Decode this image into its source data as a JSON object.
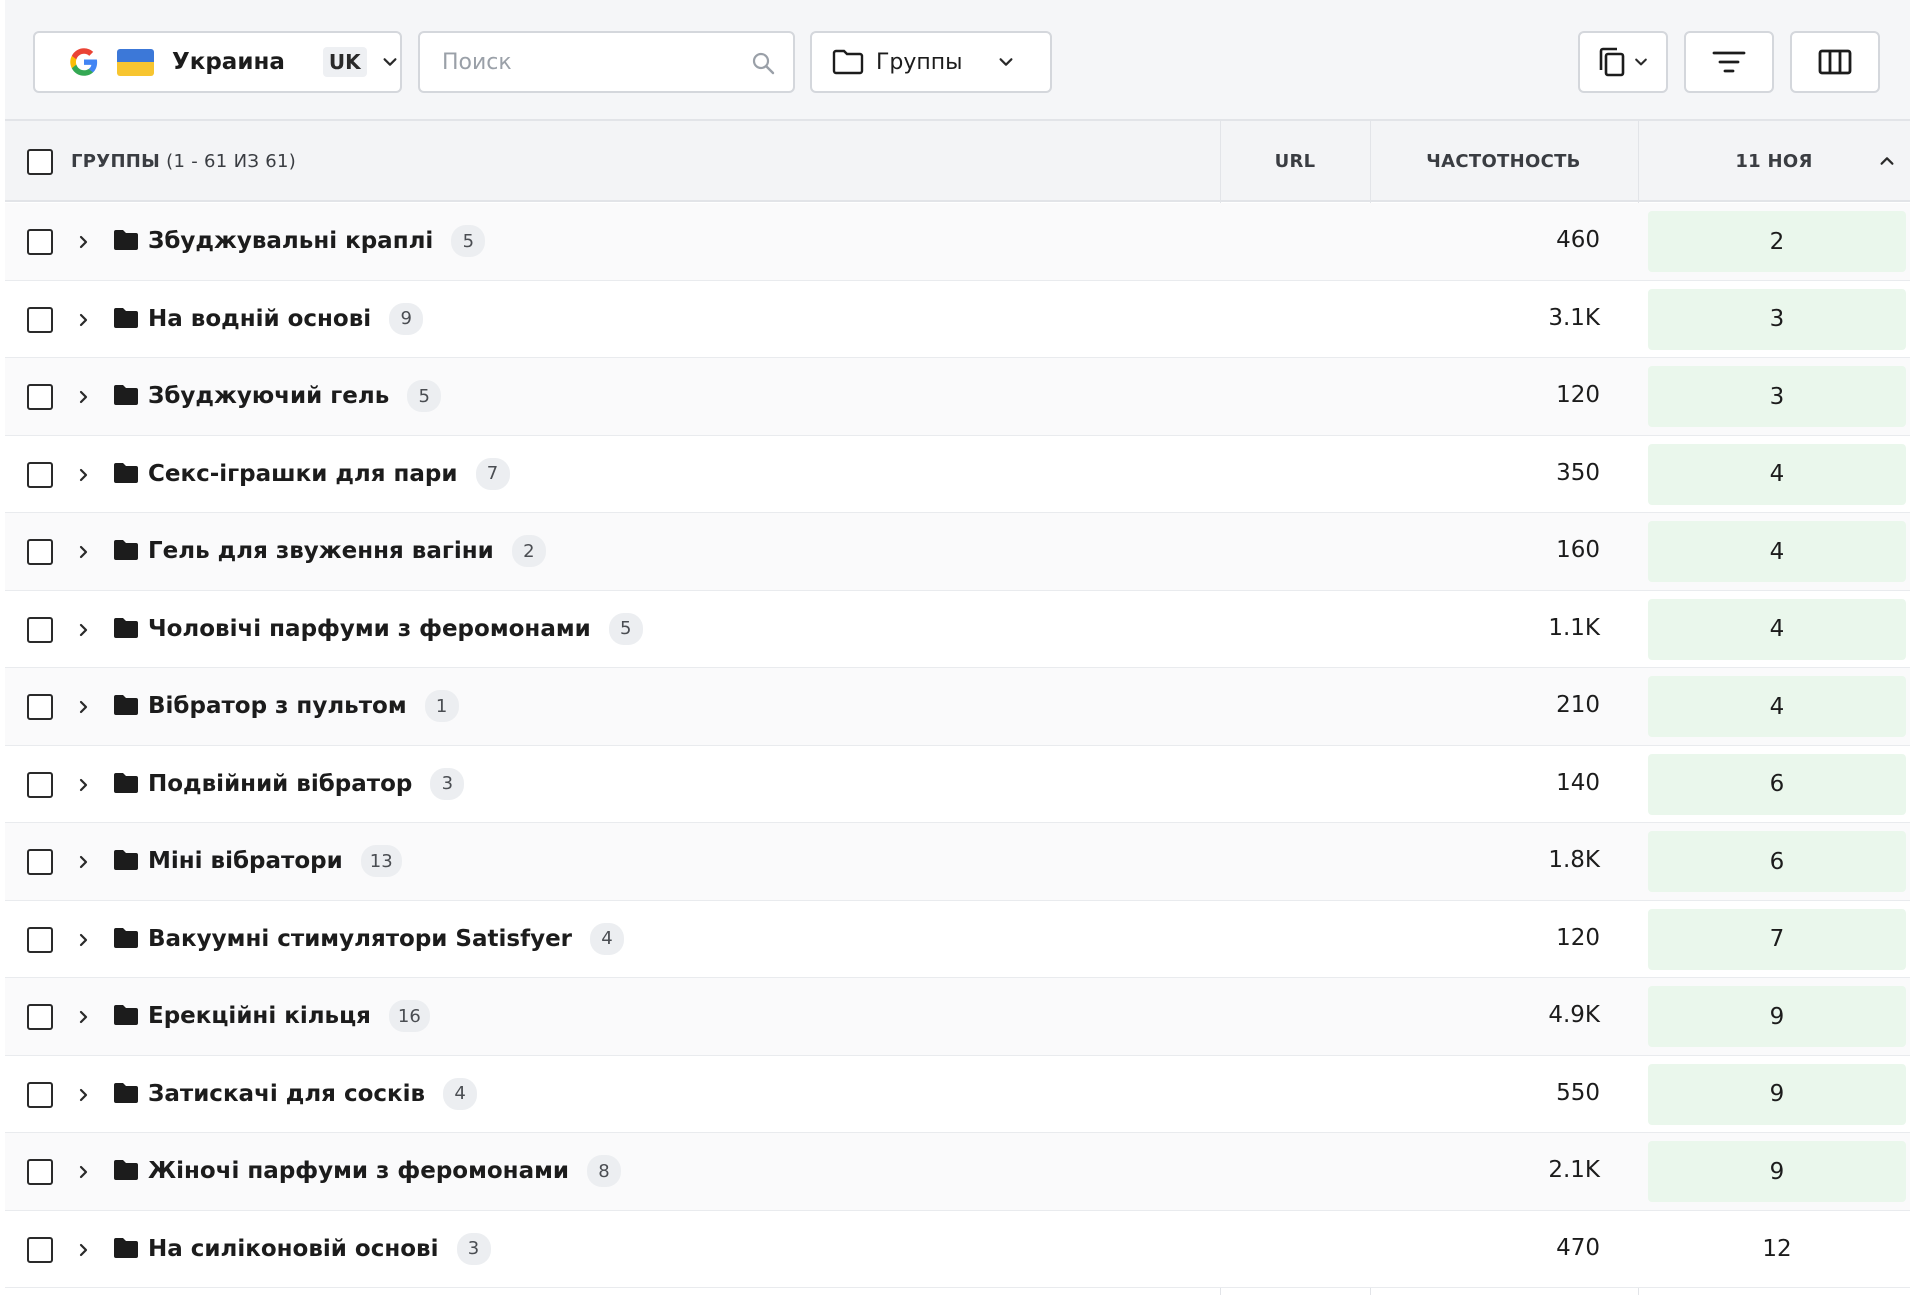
{
  "toolbar": {
    "region_name": "Украина",
    "lang_code": "UK",
    "search_placeholder": "Поиск",
    "groups_label": "Группы"
  },
  "table": {
    "header": {
      "groups_title": "ГРУППЫ",
      "groups_count": "(1 - 61 ИЗ 61)",
      "url": "URL",
      "frequency": "ЧАСТОТНОСТЬ",
      "date": "11 НОЯ"
    },
    "rows": [
      {
        "name": "Збуджувальні краплі",
        "count": "5",
        "frequency": "460",
        "position": "2",
        "highlight": true
      },
      {
        "name": "На водній основі",
        "count": "9",
        "frequency": "3.1K",
        "position": "3",
        "highlight": true
      },
      {
        "name": "Збуджуючий гель",
        "count": "5",
        "frequency": "120",
        "position": "3",
        "highlight": true
      },
      {
        "name": "Секс-іграшки для пари",
        "count": "7",
        "frequency": "350",
        "position": "4",
        "highlight": true
      },
      {
        "name": "Гель для звуження вагіни",
        "count": "2",
        "frequency": "160",
        "position": "4",
        "highlight": true
      },
      {
        "name": "Чоловічі парфуми з феромонами",
        "count": "5",
        "frequency": "1.1K",
        "position": "4",
        "highlight": true
      },
      {
        "name": "Вібратор з пультом",
        "count": "1",
        "frequency": "210",
        "position": "4",
        "highlight": true
      },
      {
        "name": "Подвійний вібратор",
        "count": "3",
        "frequency": "140",
        "position": "6",
        "highlight": true
      },
      {
        "name": "Міні вібратори",
        "count": "13",
        "frequency": "1.8K",
        "position": "6",
        "highlight": true
      },
      {
        "name": "Вакуумні стимулятори Satisfyer",
        "count": "4",
        "frequency": "120",
        "position": "7",
        "highlight": true
      },
      {
        "name": "Ерекційні кільця",
        "count": "16",
        "frequency": "4.9K",
        "position": "9",
        "highlight": true
      },
      {
        "name": "Затискачі для сосків",
        "count": "4",
        "frequency": "550",
        "position": "9",
        "highlight": true
      },
      {
        "name": "Жіночі парфуми з феромонами",
        "count": "8",
        "frequency": "2.1K",
        "position": "9",
        "highlight": true
      },
      {
        "name": "На силіконовій основі",
        "count": "3",
        "frequency": "470",
        "position": "12",
        "highlight": false
      }
    ]
  }
}
